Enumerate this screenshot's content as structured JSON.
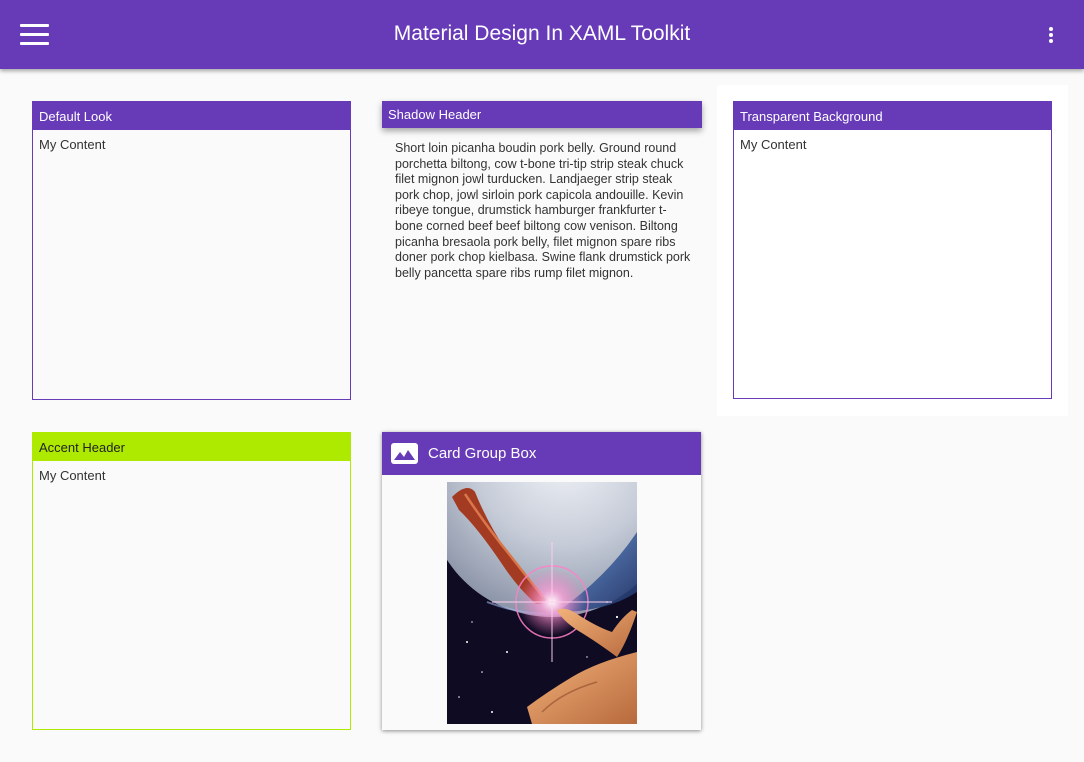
{
  "app_bar": {
    "title": "Material Design In XAML Toolkit",
    "menu_icon": "hamburger-menu-icon",
    "overflow_icon": "dots-vertical-icon",
    "background": "#673ab7"
  },
  "group_boxes": [
    {
      "header": "Default Look",
      "content": "My Content",
      "header_color": "#673ab7"
    },
    {
      "header": "Shadow Header",
      "content": "Short loin picanha boudin pork belly. Ground round porchetta biltong, cow t-bone tri-tip strip steak chuck filet mignon jowl turducken. Landjaeger strip steak pork chop, jowl sirloin pork capicola andouille. Kevin ribeye tongue, drumstick hamburger frankfurter t-bone corned beef beef biltong cow venison. Biltong picanha bresaola pork belly, filet mignon spare ribs doner pork chop kielbasa. Swine flank drumstick pork belly pancetta spare ribs rump filet mignon.",
      "header_color": "#673ab7"
    },
    {
      "header": "Transparent Background",
      "content": "My Content",
      "header_color": "#673ab7"
    },
    {
      "header": "Accent Header",
      "content": "My Content",
      "header_color": "#aeea00"
    }
  ],
  "card_group_box": {
    "header": "Card Group Box",
    "icon": "image-icon",
    "image": "space-hand-poster-image"
  },
  "colors": {
    "primary": "#673ab7",
    "accent": "#aeea00",
    "background": "#fafafa"
  }
}
